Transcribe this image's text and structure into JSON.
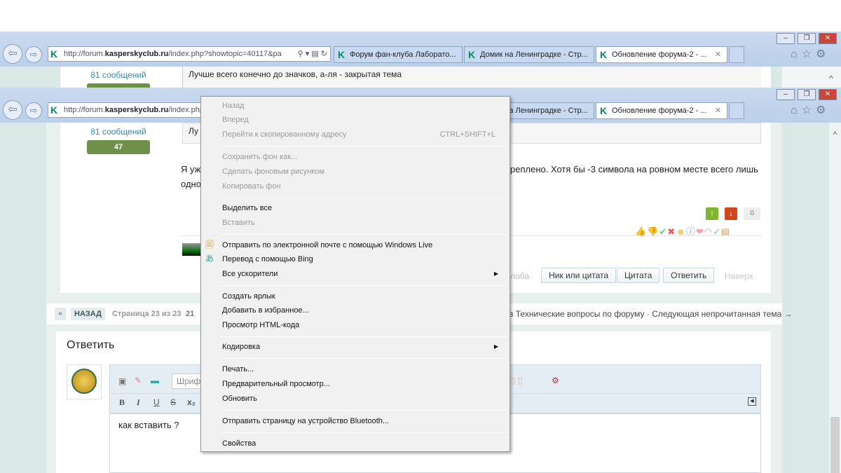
{
  "browser": {
    "url_prefix": "http://forum.",
    "url_domain": "kasperskyclub.ru",
    "url_rest": "/index.php?showtopic=40117&pa",
    "url_rest_short": "/index.php",
    "tabs": [
      {
        "label": "Форум фан-клуба Лаборато..."
      },
      {
        "label": "Домик на Ленинградке - Стр..."
      },
      {
        "label": "Обновление форума-2 - ...",
        "active": true
      }
    ],
    "window_controls": [
      "minimize",
      "restore",
      "close"
    ],
    "toolbar_icons": [
      "home-icon",
      "star-icon",
      "gear-icon"
    ]
  },
  "post": {
    "messages_count": "81 сообщений",
    "reputation": "47",
    "quote_text": "Лучше всего конечно до значков, а-ля - закрытая тема",
    "body_line1_start": "Я уж",
    "body_line1_end": "реплено. Хотя бы -3 символа на ровном месте всего лишь",
    "body_line2_start": "одно",
    "rating": {
      "up": "↑",
      "down": "↓",
      "count": "0"
    },
    "actions": {
      "complaint": "лоба",
      "nick_quote": "Ник или цитата",
      "quote": "Цитата",
      "reply": "Ответить",
      "top": "Наверх"
    }
  },
  "pagination": {
    "first": "«",
    "back": "НАЗАД",
    "page_info": "Страница 23 из 23",
    "page_num": "21",
    "right_text": "в Технические вопросы по форуму · Следующая непрочитанная тема →"
  },
  "reply": {
    "title": "Ответить",
    "font_select": "Шрифт",
    "format_buttons": [
      "B",
      "I",
      "U",
      "S",
      "x₂"
    ],
    "editor_text": "как вставить ?"
  },
  "context_menu": [
    {
      "label": "Назад",
      "disabled": true
    },
    {
      "label": "Вперед",
      "disabled": true
    },
    {
      "label": "Перейти к скопированному адресу",
      "disabled": true,
      "shortcut": "CTRL+SHIFT+L"
    },
    {
      "label": "Сохранить фон как...",
      "disabled": true
    },
    {
      "label": "Сделать фоновым рисунком",
      "disabled": true
    },
    {
      "label": "Копировать фон",
      "disabled": true
    },
    {
      "label": "Выделить все"
    },
    {
      "label": "Вставить",
      "disabled": true
    },
    {
      "label": "Отправить по электронной почте с помощью Windows Live",
      "icon": "windows-live-mail-icon"
    },
    {
      "label": "Перевод с помощью Bing",
      "icon": "bing-translate-icon"
    },
    {
      "label": "Все ускорители",
      "submenu": true
    },
    {
      "label": "Создать ярлык"
    },
    {
      "label": "Добавить в избранное..."
    },
    {
      "label": "Просмотр HTML-кода"
    },
    {
      "label": "Кодировка",
      "submenu": true
    },
    {
      "label": "Печать..."
    },
    {
      "label": "Предварительный просмотр..."
    },
    {
      "label": "Обновить"
    },
    {
      "label": "Отправить страницу на устройство Bluetooth..."
    },
    {
      "label": "Свойства"
    }
  ],
  "colors": {
    "reputation_green": "#6f8f4a",
    "page_bg": "#dbe9e6",
    "chrome": "#c4d6ee"
  }
}
